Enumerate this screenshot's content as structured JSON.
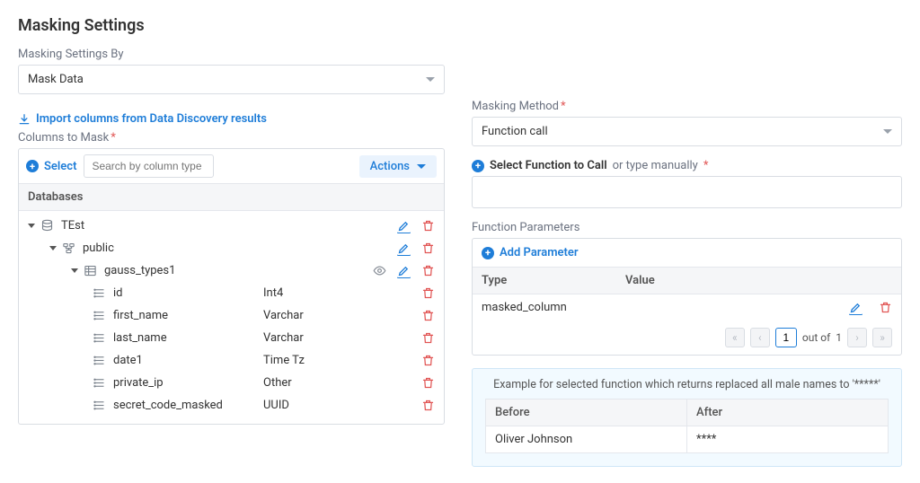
{
  "title": "Masking Settings",
  "settings_by": {
    "label": "Masking Settings By",
    "value": "Mask Data"
  },
  "import_link": "Import columns from Data Discovery results",
  "columns_to_mask_label": "Columns to Mask",
  "select_label": "Select",
  "search_placeholder": "Search by column type",
  "actions_label": "Actions",
  "databases_header": "Databases",
  "tree": {
    "db_name": "TEst",
    "schema_name": "public",
    "table_name": "gauss_types1",
    "columns": [
      {
        "name": "id",
        "type": "Int4"
      },
      {
        "name": "first_name",
        "type": "Varchar"
      },
      {
        "name": "last_name",
        "type": "Varchar"
      },
      {
        "name": "date1",
        "type": "Time Tz"
      },
      {
        "name": "private_ip",
        "type": "Other"
      },
      {
        "name": "secret_code_masked",
        "type": "UUID"
      }
    ]
  },
  "masking_method": {
    "label": "Masking Method",
    "value": "Function call"
  },
  "select_function": {
    "strong": "Select Function to Call",
    "muted": "or type manually"
  },
  "fn_params": {
    "section_label": "Function Parameters",
    "add_label": "Add Parameter",
    "th_type": "Type",
    "th_value": "Value",
    "row_type": "masked_column",
    "out_of": "out of",
    "page": "1",
    "total": "1"
  },
  "example": {
    "title": "Example for selected function which returns replaced all male names to '*****'",
    "before_h": "Before",
    "after_h": "After",
    "before_v": "Oliver Johnson",
    "after_v": "****"
  }
}
